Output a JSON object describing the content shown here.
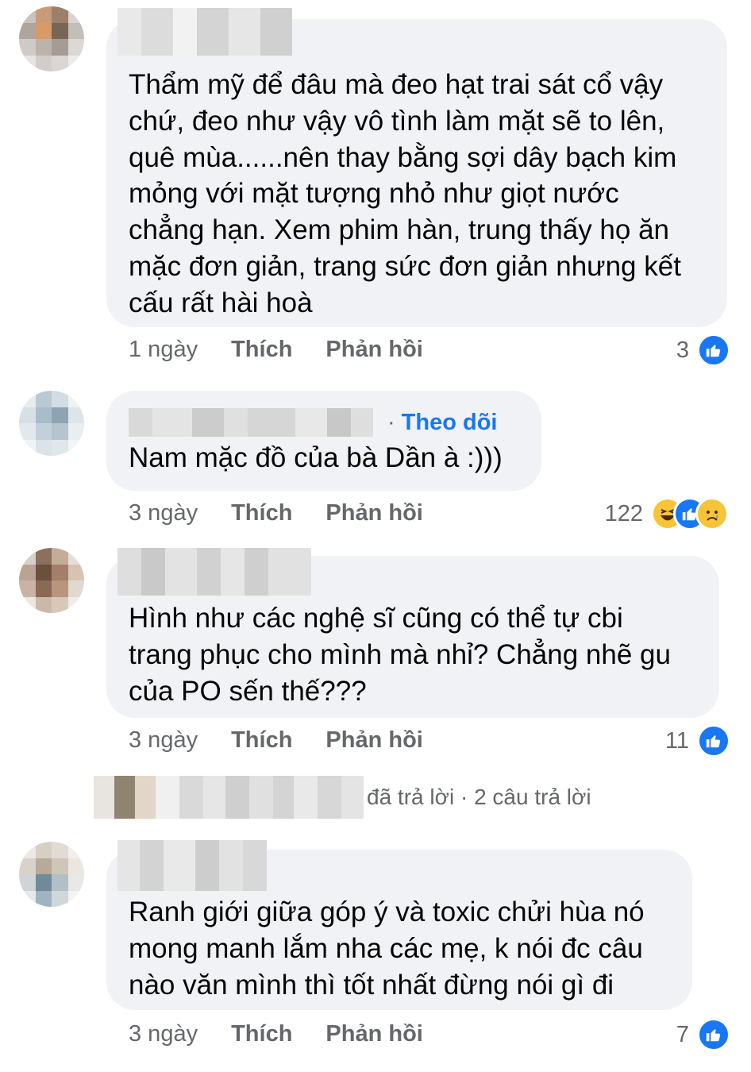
{
  "comments": [
    {
      "text": "Thẩm mỹ để đâu mà đeo hạt trai sát cổ vậy\nchứ, đeo như vậy vô tình làm mặt sẽ to lên,\nquê mùa......nên thay bằng sợi dây bạch kim\nmỏng với mặt tượng nhỏ như giọt nước\nchẳng hạn. Xem phim hàn, trung thấy họ ăn\nmặc đơn giản, trang sức đơn giản nhưng kết\ncấu rất hài hoà",
      "time": "1 ngày",
      "like_label": "Thích",
      "reply_label": "Phản hồi",
      "reaction_count": "3",
      "reactions": [
        "like-icon"
      ]
    },
    {
      "follow_label": "Theo dõi",
      "text": "Nam mặc đồ của bà Dần à :)))",
      "time": "3 ngày",
      "like_label": "Thích",
      "reply_label": "Phản hồi",
      "reaction_count": "122",
      "reactions": [
        "haha-icon",
        "like-icon",
        "sad-icon"
      ]
    },
    {
      "text": "Hình như các nghệ sĩ cũng có thể tự cbi\ntrang phục cho mình mà nhỉ? Chẳng nhẽ gu\ncủa PO sến thế???",
      "time": "3 ngày",
      "like_label": "Thích",
      "reply_label": "Phản hồi",
      "reaction_count": "11",
      "reactions": [
        "like-icon"
      ]
    },
    {
      "text": "Ranh giới giữa góp ý và toxic chửi hùa nó\nmong manh lắm nha các mẹ, k nói đc câu\nnào văn mình thì tốt nhất đừng nói gì đi",
      "time": "3 ngày",
      "like_label": "Thích",
      "reply_label": "Phản hồi",
      "reaction_count": "7",
      "reactions": [
        "like-icon"
      ]
    }
  ],
  "replies_summary": {
    "text": "đã trả lời · 2 câu trả lời"
  },
  "colors": {
    "bubble": "#f0f2f5",
    "secondary_text": "#65676b",
    "link_blue": "#1877f2"
  }
}
